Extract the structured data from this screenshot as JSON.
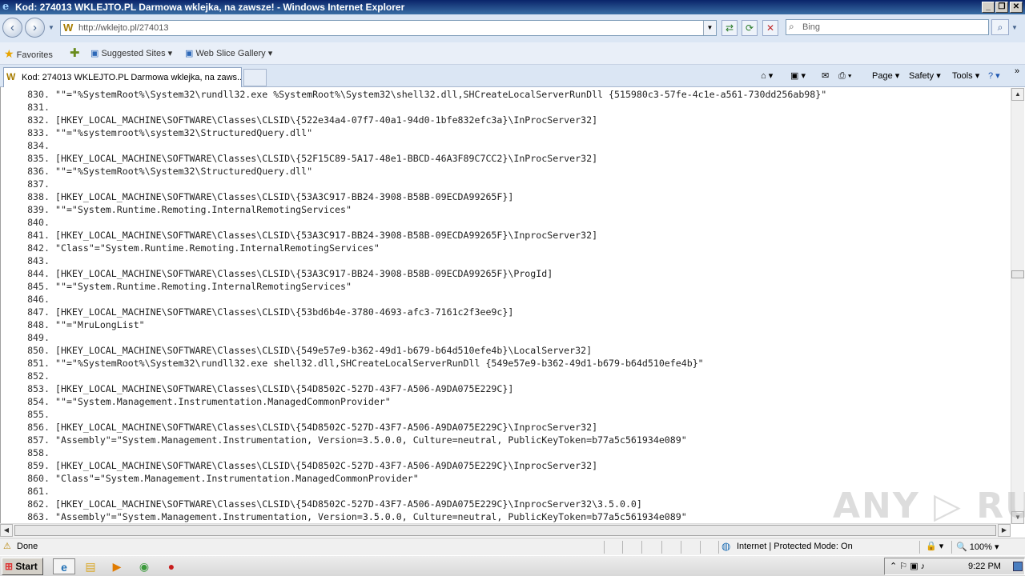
{
  "window": {
    "title": "Kod: 274013 WKLEJTO.PL Darmowa wklejka, na zawsze! - Windows Internet Explorer",
    "controls": {
      "minimize": "_",
      "restore": "❐",
      "close": "✕"
    }
  },
  "toolbar": {
    "back_icon": "‹",
    "forward_icon": "›",
    "address_favicon": "W",
    "address_url": "http://wklejto.pl/274013",
    "dropdown_glyph": "▼",
    "refresh_icon": "⟳",
    "compat_icon": "⇄",
    "stop_icon": "✕",
    "search_placeholder": "Bing",
    "search_icon": "⌕",
    "search_go_icon": "⌕"
  },
  "favorites_bar": {
    "favorites_label": "Favorites",
    "suggested_sites": "Suggested Sites ▾",
    "web_slice_gallery": "Web Slice Gallery ▾"
  },
  "tabs": [
    {
      "favicon": "W",
      "label": "Kod: 274013 WKLEJTO.PL Darmowa wklejka, na zaws..."
    }
  ],
  "command_bar": {
    "home_icon": "⌂ ▾",
    "feeds_icon": "▣ ▾",
    "mail_icon": "✉",
    "print_icon": "⎙ ▾",
    "page_label": "Page ▾",
    "safety_label": "Safety ▾",
    "tools_label": "Tools ▾",
    "help_icon": "? ▾",
    "more_icon": "»"
  },
  "code": [
    {
      "n": "830.",
      "t": "\"\"=\"%SystemRoot%\\System32\\rundll32.exe %SystemRoot%\\System32\\shell32.dll,SHCreateLocalServerRunDll {515980c3-57fe-4c1e-a561-730dd256ab98}\""
    },
    {
      "n": "831.",
      "t": ""
    },
    {
      "n": "832.",
      "t": "[HKEY_LOCAL_MACHINE\\SOFTWARE\\Classes\\CLSID\\{522e34a4-07f7-40a1-94d0-1bfe832efc3a}\\InProcServer32]"
    },
    {
      "n": "833.",
      "t": "\"\"=\"%systemroot%\\system32\\StructuredQuery.dll\""
    },
    {
      "n": "834.",
      "t": ""
    },
    {
      "n": "835.",
      "t": "[HKEY_LOCAL_MACHINE\\SOFTWARE\\Classes\\CLSID\\{52F15C89-5A17-48e1-BBCD-46A3F89C7CC2}\\InProcServer32]"
    },
    {
      "n": "836.",
      "t": "\"\"=\"%SystemRoot%\\System32\\StructuredQuery.dll\""
    },
    {
      "n": "837.",
      "t": ""
    },
    {
      "n": "838.",
      "t": "[HKEY_LOCAL_MACHINE\\SOFTWARE\\Classes\\CLSID\\{53A3C917-BB24-3908-B58B-09ECDA99265F}]"
    },
    {
      "n": "839.",
      "t": "\"\"=\"System.Runtime.Remoting.InternalRemotingServices\""
    },
    {
      "n": "840.",
      "t": ""
    },
    {
      "n": "841.",
      "t": "[HKEY_LOCAL_MACHINE\\SOFTWARE\\Classes\\CLSID\\{53A3C917-BB24-3908-B58B-09ECDA99265F}\\InprocServer32]"
    },
    {
      "n": "842.",
      "t": "\"Class\"=\"System.Runtime.Remoting.InternalRemotingServices\""
    },
    {
      "n": "843.",
      "t": ""
    },
    {
      "n": "844.",
      "t": "[HKEY_LOCAL_MACHINE\\SOFTWARE\\Classes\\CLSID\\{53A3C917-BB24-3908-B58B-09ECDA99265F}\\ProgId]"
    },
    {
      "n": "845.",
      "t": "\"\"=\"System.Runtime.Remoting.InternalRemotingServices\""
    },
    {
      "n": "846.",
      "t": ""
    },
    {
      "n": "847.",
      "t": "[HKEY_LOCAL_MACHINE\\SOFTWARE\\Classes\\CLSID\\{53bd6b4e-3780-4693-afc3-7161c2f3ee9c}]"
    },
    {
      "n": "848.",
      "t": "\"\"=\"MruLongList\""
    },
    {
      "n": "849.",
      "t": ""
    },
    {
      "n": "850.",
      "t": "[HKEY_LOCAL_MACHINE\\SOFTWARE\\Classes\\CLSID\\{549e57e9-b362-49d1-b679-b64d510efe4b}\\LocalServer32]"
    },
    {
      "n": "851.",
      "t": "\"\"=\"%SystemRoot%\\System32\\rundll32.exe shell32.dll,SHCreateLocalServerRunDll {549e57e9-b362-49d1-b679-b64d510efe4b}\""
    },
    {
      "n": "852.",
      "t": ""
    },
    {
      "n": "853.",
      "t": "[HKEY_LOCAL_MACHINE\\SOFTWARE\\Classes\\CLSID\\{54D8502C-527D-43F7-A506-A9DA075E229C}]"
    },
    {
      "n": "854.",
      "t": "\"\"=\"System.Management.Instrumentation.ManagedCommonProvider\""
    },
    {
      "n": "855.",
      "t": ""
    },
    {
      "n": "856.",
      "t": "[HKEY_LOCAL_MACHINE\\SOFTWARE\\Classes\\CLSID\\{54D8502C-527D-43F7-A506-A9DA075E229C}\\InprocServer32]"
    },
    {
      "n": "857.",
      "t": "\"Assembly\"=\"System.Management.Instrumentation, Version=3.5.0.0, Culture=neutral, PublicKeyToken=b77a5c561934e089\""
    },
    {
      "n": "858.",
      "t": ""
    },
    {
      "n": "859.",
      "t": "[HKEY_LOCAL_MACHINE\\SOFTWARE\\Classes\\CLSID\\{54D8502C-527D-43F7-A506-A9DA075E229C}\\InprocServer32]"
    },
    {
      "n": "860.",
      "t": "\"Class\"=\"System.Management.Instrumentation.ManagedCommonProvider\""
    },
    {
      "n": "861.",
      "t": ""
    },
    {
      "n": "862.",
      "t": "[HKEY_LOCAL_MACHINE\\SOFTWARE\\Classes\\CLSID\\{54D8502C-527D-43F7-A506-A9DA075E229C}\\InprocServer32\\3.5.0.0]"
    },
    {
      "n": "863.",
      "t": "\"Assembly\"=\"System.Management.Instrumentation, Version=3.5.0.0, Culture=neutral, PublicKeyToken=b77a5c561934e089\""
    }
  ],
  "status_bar": {
    "warning_icon": "⚠",
    "status_text": "Done",
    "zone_icon": "◍",
    "zone_text": "Internet | Protected Mode: On",
    "zoom_text": "🔍 100% ▾"
  },
  "taskbar": {
    "start_label": "Start",
    "clock": "9:22 PM",
    "ie_icon": "e",
    "explorer_icon": "▤",
    "media_icon": "▶",
    "chrome_icon": "◉",
    "stop_app_icon": "●",
    "tray_icons": "⌃ ⚐ ▣ ♪"
  },
  "watermark": "ANY ▷ RUN",
  "colors": {
    "titlebar": "#0a246a",
    "chrome_bg": "#dbe6f4",
    "content_text": "#222222"
  }
}
